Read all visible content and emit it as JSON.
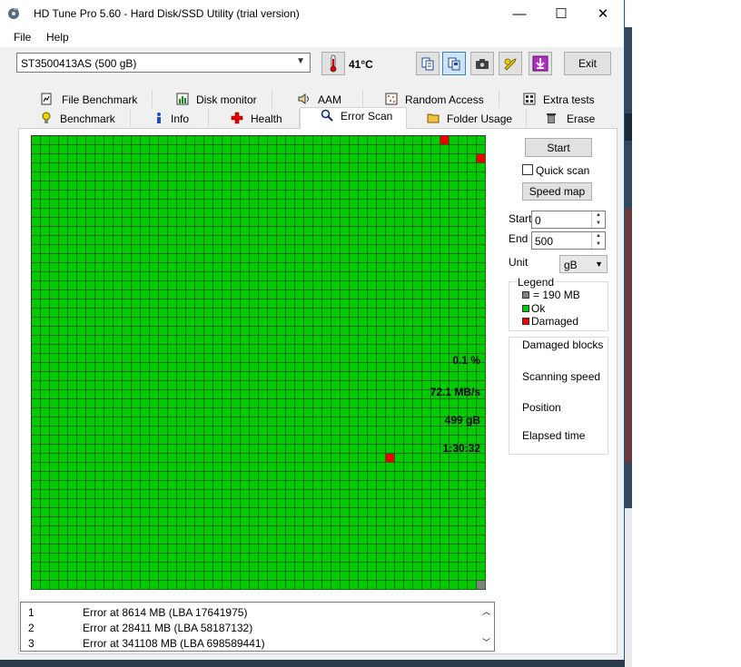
{
  "window": {
    "title": "HD Tune Pro 5.60 - Hard Disk/SSD Utility (trial version)",
    "controls": {
      "minimize": "—",
      "maximize": "☐",
      "close": "✕"
    }
  },
  "menu": {
    "file": "File",
    "help": "Help"
  },
  "toolbar": {
    "drive": "ST3500413AS (500 gB)",
    "temperature": "41°C",
    "exit_label": "Exit"
  },
  "tabs": {
    "row1": [
      {
        "label": "File Benchmark",
        "icon": "file-benchmark-icon"
      },
      {
        "label": "Disk monitor",
        "icon": "disk-monitor-icon"
      },
      {
        "label": "AAM",
        "icon": "speaker-icon"
      },
      {
        "label": "Random Access",
        "icon": "random-access-icon"
      },
      {
        "label": "Extra tests",
        "icon": "extra-tests-icon"
      }
    ],
    "row2": [
      {
        "label": "Benchmark",
        "icon": "bulb-icon"
      },
      {
        "label": "Info",
        "icon": "info-icon"
      },
      {
        "label": "Health",
        "icon": "health-cross-icon"
      },
      {
        "label": "Error Scan",
        "icon": "magnifier-icon"
      },
      {
        "label": "Folder Usage",
        "icon": "folder-icon"
      },
      {
        "label": "Erase",
        "icon": "trash-icon"
      }
    ],
    "active": "Error Scan"
  },
  "scan_map": {
    "columns": 50,
    "rows": 50,
    "damaged_blocks": [
      [
        45,
        0
      ],
      [
        49,
        2
      ],
      [
        39,
        35
      ]
    ],
    "current_block": [
      49,
      49
    ],
    "colors": {
      "ok": "#00cc00",
      "damaged": "#ee0000",
      "current": "#808080",
      "cell_border": "#1a6a1a"
    }
  },
  "controls": {
    "start_button": "Start",
    "quick_scan": "Quick scan",
    "quick_scan_checked": false,
    "speed_map_button": "Speed map",
    "start_label": "Start",
    "start_value": "0",
    "end_label": "End",
    "end_value": "500",
    "unit_label": "Unit",
    "unit_value": "gB"
  },
  "legend": {
    "title": "Legend",
    "block_size": "= 190 MB",
    "ok": "Ok",
    "damaged": "Damaged"
  },
  "stats": {
    "damaged_blocks_label": "Damaged blocks",
    "damaged_blocks_value": "0.1 %",
    "scanning_speed_label": "Scanning speed",
    "scanning_speed_value": "72.1 MB/s",
    "position_label": "Position",
    "position_value": "499 gB",
    "elapsed_label": "Elapsed time",
    "elapsed_value": "1:30:32"
  },
  "errors": [
    {
      "n": "1",
      "msg": "Error at 8614 MB (LBA 17641975)"
    },
    {
      "n": "2",
      "msg": "Error at 28411 MB (LBA 58187132)"
    },
    {
      "n": "3",
      "msg": "Error at 341108 MB (LBA 698589441)"
    }
  ]
}
